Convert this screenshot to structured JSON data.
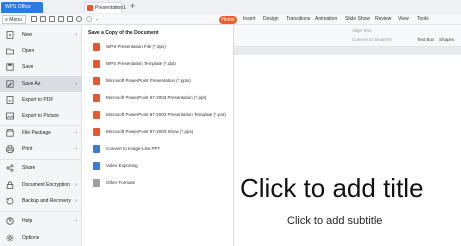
{
  "titlebar": {
    "app_tab": "WPS Office",
    "doc_tab": "Presentation1",
    "new_tab": "+"
  },
  "toolbar": {
    "menu_label": "≡ Menu",
    "ribbon_tabs": [
      "Home",
      "Insert",
      "Design",
      "Transitions",
      "Animation",
      "Slide Show",
      "Review",
      "View",
      "Tools"
    ]
  },
  "sidebar": {
    "items": [
      {
        "label": "New",
        "icon": "new-doc-icon",
        "arrow": "›"
      },
      {
        "label": "Open",
        "icon": "folder-icon",
        "arrow": ""
      },
      {
        "label": "Save",
        "icon": "save-icon",
        "arrow": ""
      },
      {
        "label": "Save As",
        "icon": "save-as-icon",
        "arrow": "›"
      },
      {
        "label": "Export to PDF",
        "icon": "pdf-icon",
        "arrow": ""
      },
      {
        "label": "Export to Picture",
        "icon": "picture-icon",
        "arrow": ""
      },
      {
        "label": "File Package",
        "icon": "package-icon",
        "arrow": "›"
      },
      {
        "label": "Print",
        "icon": "print-icon",
        "arrow": "›"
      },
      {
        "label": "Share",
        "icon": "share-icon",
        "arrow": ""
      },
      {
        "label": "Document Encryption",
        "icon": "lock-icon",
        "arrow": "›"
      },
      {
        "label": "Backup and Recovery",
        "icon": "backup-icon",
        "arrow": "›"
      },
      {
        "label": "Help",
        "icon": "help-icon",
        "arrow": "›"
      },
      {
        "label": "Options",
        "icon": "gear-icon",
        "arrow": ""
      }
    ]
  },
  "flyout": {
    "heading": "Save a Copy of the Document",
    "items": [
      {
        "label": "WPS Presentation File (*.dps)",
        "icon": "dps-file-icon",
        "color": "#e8572f"
      },
      {
        "label": "WPS Presentation Template (*.dpt)",
        "icon": "dpt-file-icon",
        "color": "#e8572f"
      },
      {
        "label": "Microsoft PowerPoint Presentation (*.pptx)",
        "icon": "pptx-file-icon",
        "color": "#e8572f"
      },
      {
        "label": "Microsoft PowerPoint 97-2003 Presentation (*.ppt)",
        "icon": "ppt-file-icon",
        "color": "#e8572f"
      },
      {
        "label": "Microsoft PowerPoint 97-2003 Presentation Template (*.pot)",
        "icon": "pot-file-icon",
        "color": "#e8572f"
      },
      {
        "label": "Microsoft PowerPoint 97-2003 Show (*.pps)",
        "icon": "pps-file-icon",
        "color": "#e8572f"
      },
      {
        "label": "Convert to Image-Like PPT",
        "icon": "image-ppt-icon",
        "color": "#3a7bd5"
      },
      {
        "label": "Video Exporting",
        "icon": "video-icon",
        "color": "#3a7bd5"
      },
      {
        "label": "Other Formats",
        "icon": "other-formats-icon",
        "color": "#9aa0a6"
      }
    ]
  },
  "ribbon_area": {
    "align_text": "Align Text",
    "convert_smartart": "Convert to SmartArt",
    "text_box": "Text Box",
    "shapes": "Shapes"
  },
  "slide": {
    "title": "Click to add title",
    "subtitle": "Click to add subtitle"
  },
  "colors": {
    "accent": "#2b79e3",
    "home_tab": "#f25c28",
    "active_item": "#d9dde3"
  }
}
